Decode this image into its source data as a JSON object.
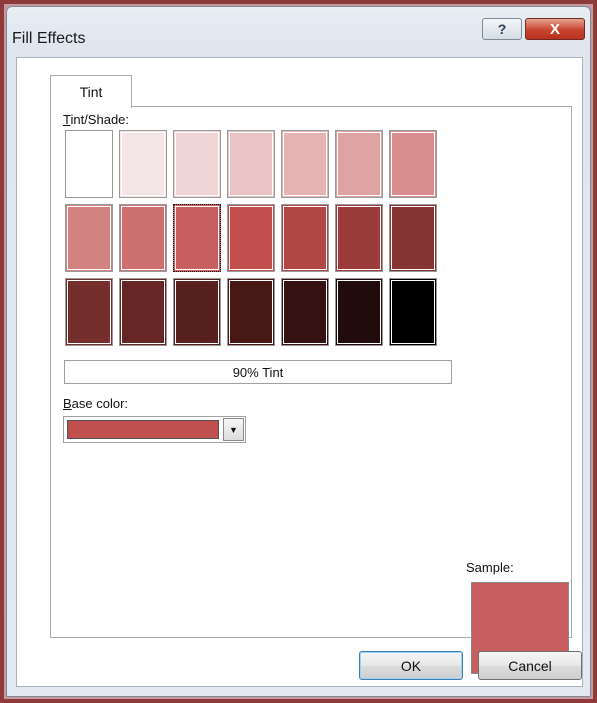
{
  "window": {
    "title": "Fill Effects",
    "help_label": "?",
    "close_label": "X"
  },
  "tabs": [
    {
      "label": "Tint",
      "selected": true
    }
  ],
  "tint_shade": {
    "label_accel": "T",
    "label_rest": "int/Shade:",
    "swatches": [
      [
        "#ffffff",
        "#f4e6e6",
        "#f0d5d7",
        "#ebc5c6",
        "#e5b4b4",
        "#dfa3a3",
        "#d88e8f"
      ],
      [
        "#d38282",
        "#cd7070",
        "#c85f5f",
        "#c24f4d",
        "#b14744",
        "#9c3c3a",
        "#843432"
      ],
      [
        "#742e2c",
        "#662826",
        "#56201e",
        "#461816",
        "#361212",
        "#220b0b",
        "#000000"
      ]
    ],
    "selected_row": 1,
    "selected_col": 2,
    "tint_value": "90% Tint"
  },
  "base_color": {
    "label_accel": "B",
    "label_rest": "ase color:",
    "color": "#c0504d"
  },
  "sample": {
    "label": "Sample:",
    "color": "#c85f5f"
  },
  "buttons": {
    "ok_label": "OK",
    "cancel_label": "Cancel"
  },
  "icons": {
    "help": "question-mark-icon",
    "close": "close-x-icon",
    "dropdown": "triangle-down-icon"
  }
}
